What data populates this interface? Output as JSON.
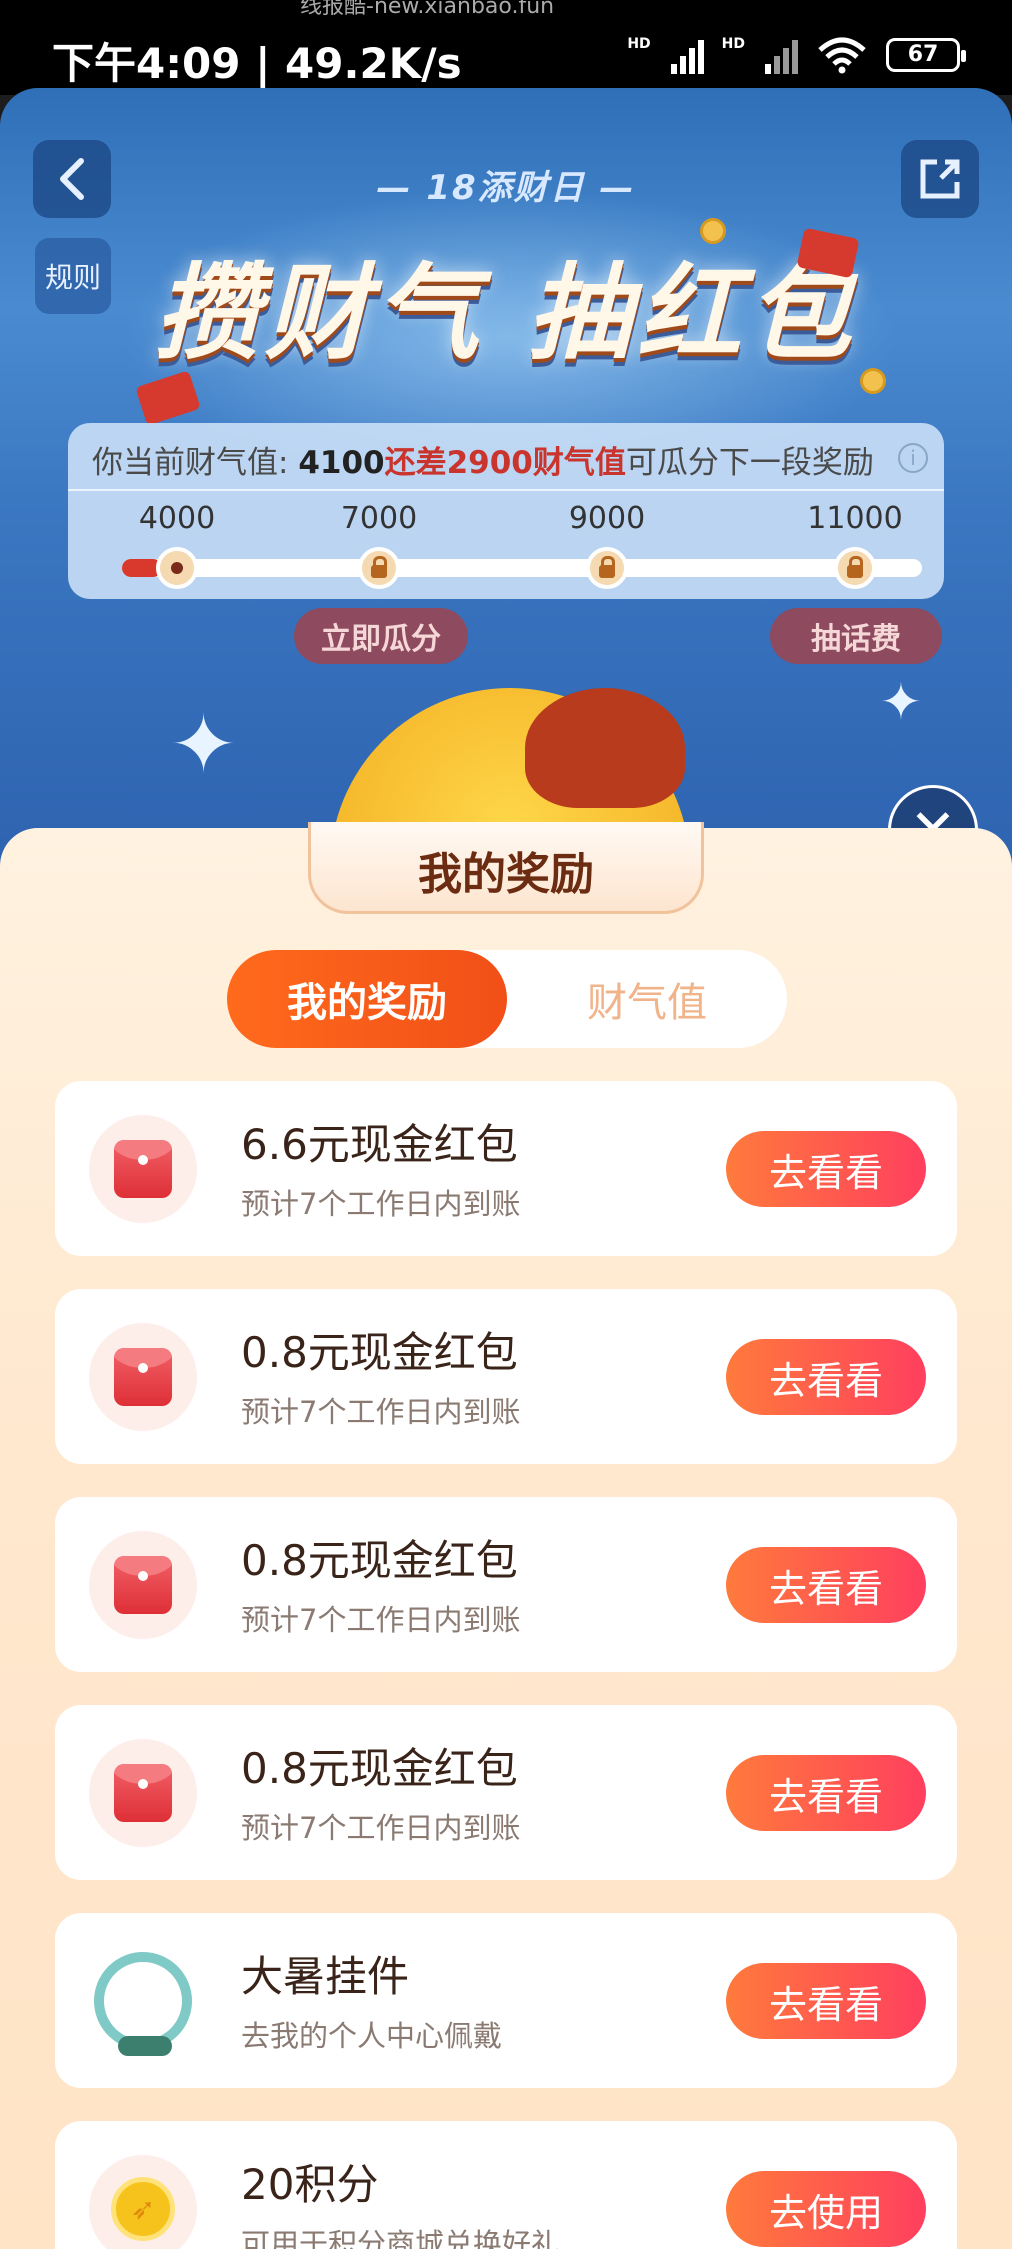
{
  "status_bar": {
    "watermark": "线报酷-new.xianbao.fun",
    "time": "下午4:09 | 49.2K/s",
    "hd1": "HD",
    "hd2": "HD",
    "battery": "67"
  },
  "hero": {
    "rules_label": "规则",
    "event_label": "— 18添财日 —",
    "event_title": "攒财气 抽红包",
    "progress": {
      "info_prefix": "你当前财气值: ",
      "current_value": "4100",
      "info_gap": "还差2900财气值",
      "info_suffix": "可瓜分下一段奖励",
      "milestones": [
        "4000",
        "7000",
        "9000",
        "11000"
      ],
      "fill_fraction": 0.05
    },
    "claim_button": "立即瓜分",
    "phone_credit_button": "抽话费"
  },
  "sheet": {
    "title": "我的奖励",
    "tabs": [
      {
        "label": "我的奖励",
        "active": true
      },
      {
        "label": "财气值",
        "active": false
      }
    ],
    "rewards": [
      {
        "title": "6.6元现金红包",
        "subtitle": "预计7个工作日内到账",
        "action": "去看看",
        "icon": "red-envelope-icon"
      },
      {
        "title": "0.8元现金红包",
        "subtitle": "预计7个工作日内到账",
        "action": "去看看",
        "icon": "red-envelope-icon"
      },
      {
        "title": "0.8元现金红包",
        "subtitle": "预计7个工作日内到账",
        "action": "去看看",
        "icon": "red-envelope-icon"
      },
      {
        "title": "0.8元现金红包",
        "subtitle": "预计7个工作日内到账",
        "action": "去看看",
        "icon": "red-envelope-icon"
      },
      {
        "title": "大暑挂件",
        "subtitle": "去我的个人中心佩戴",
        "action": "去看看",
        "icon": "avatar-frame-icon"
      },
      {
        "title": "20积分",
        "subtitle": "可用于积分商城兑换好礼",
        "action": "去使用",
        "icon": "points-coin-icon"
      }
    ]
  },
  "colors": {
    "accent_orange": "#f14f17",
    "button_gradient_end": "#ff3f5e",
    "highlight_red": "#c9342c"
  }
}
